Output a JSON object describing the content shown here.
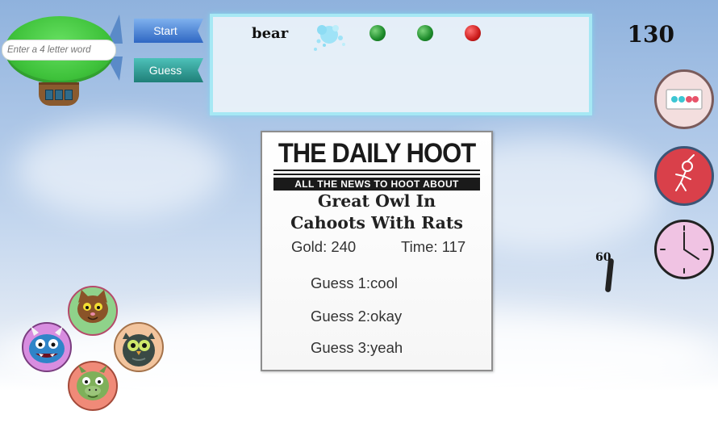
{
  "blimp": {
    "input_placeholder": "Enter a 4 letter word"
  },
  "buttons": {
    "start": "Start",
    "guess": "Guess"
  },
  "word_panel": {
    "current_word": "bear",
    "result_dots": [
      "green",
      "green",
      "red"
    ]
  },
  "score": "130",
  "side_buttons": {
    "hint_icon": "dots-card-icon",
    "hangman_icon": "hangman-icon",
    "clock_icon": "clock-icon"
  },
  "small_timer": "60",
  "newspaper": {
    "title": "THE DAILY HOOT",
    "tagline": "ALL THE NEWS TO HOOT ABOUT",
    "headline_line1": "Great Owl In",
    "headline_line2": "Cahoots With Rats",
    "gold": "Gold: 240",
    "time": "Time: 117",
    "guesses": [
      "Guess 1:cool",
      "Guess 2:okay",
      "Guess 3:yeah"
    ]
  },
  "characters": [
    "cat",
    "monster",
    "owl",
    "dragon"
  ],
  "colors": {
    "start_button": "#2f67c3",
    "guess_button": "#1f7f78",
    "blimp": "#3fc23b",
    "dot_green": "#1c8a2a",
    "dot_red": "#cc1b1b"
  }
}
